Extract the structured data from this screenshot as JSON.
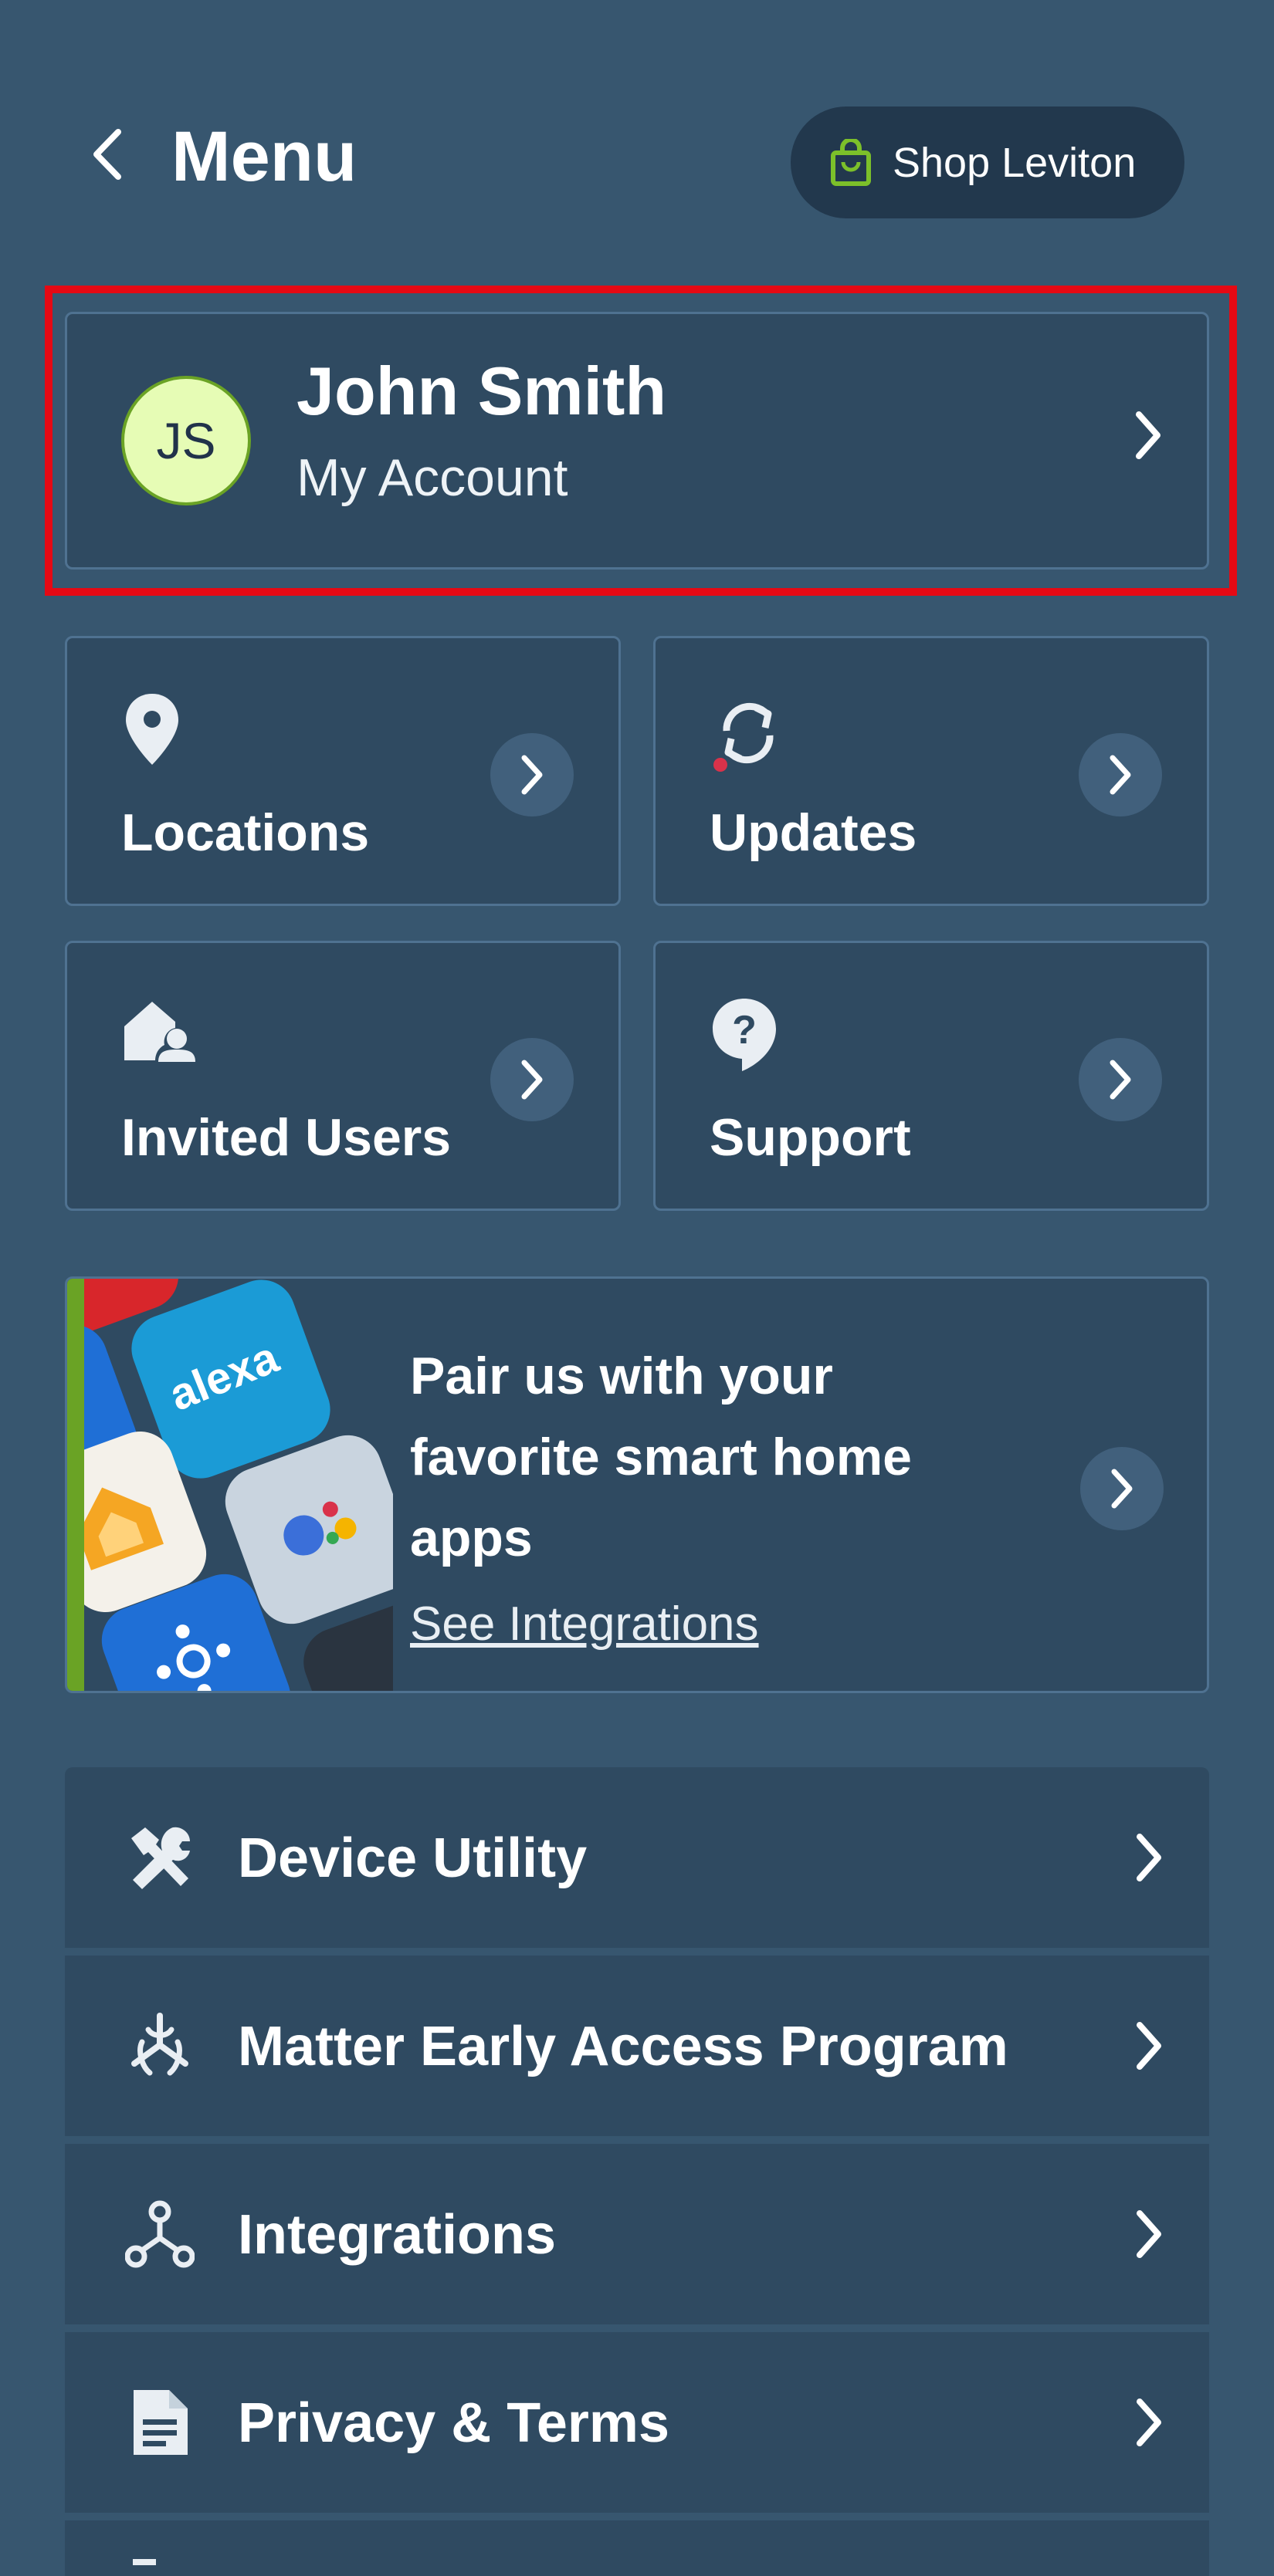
{
  "header": {
    "title": "Menu",
    "shop_label": "Shop Leviton"
  },
  "account": {
    "initials": "JS",
    "name": "John Smith",
    "subtitle": "My Account"
  },
  "tiles": [
    {
      "label": "Locations",
      "icon": "location-pin-icon"
    },
    {
      "label": "Updates",
      "icon": "sync-update-icon"
    },
    {
      "label": "Invited Users",
      "icon": "home-user-icon"
    },
    {
      "label": "Support",
      "icon": "question-bubble-icon"
    }
  ],
  "banner": {
    "headline": "Pair us with your favorite smart home apps",
    "link": "See Integrations",
    "app_logo_text": "alexa"
  },
  "list": [
    {
      "label": "Device Utility",
      "icon": "tools-icon"
    },
    {
      "label": "Matter Early Access Program",
      "icon": "matter-icon"
    },
    {
      "label": "Integrations",
      "icon": "integrations-icon"
    },
    {
      "label": "Privacy & Terms",
      "icon": "document-icon"
    }
  ],
  "colors": {
    "background": "#37566f",
    "card": "#2f4a61",
    "accent_green": "#6aa325",
    "highlight_red": "#e50914"
  }
}
